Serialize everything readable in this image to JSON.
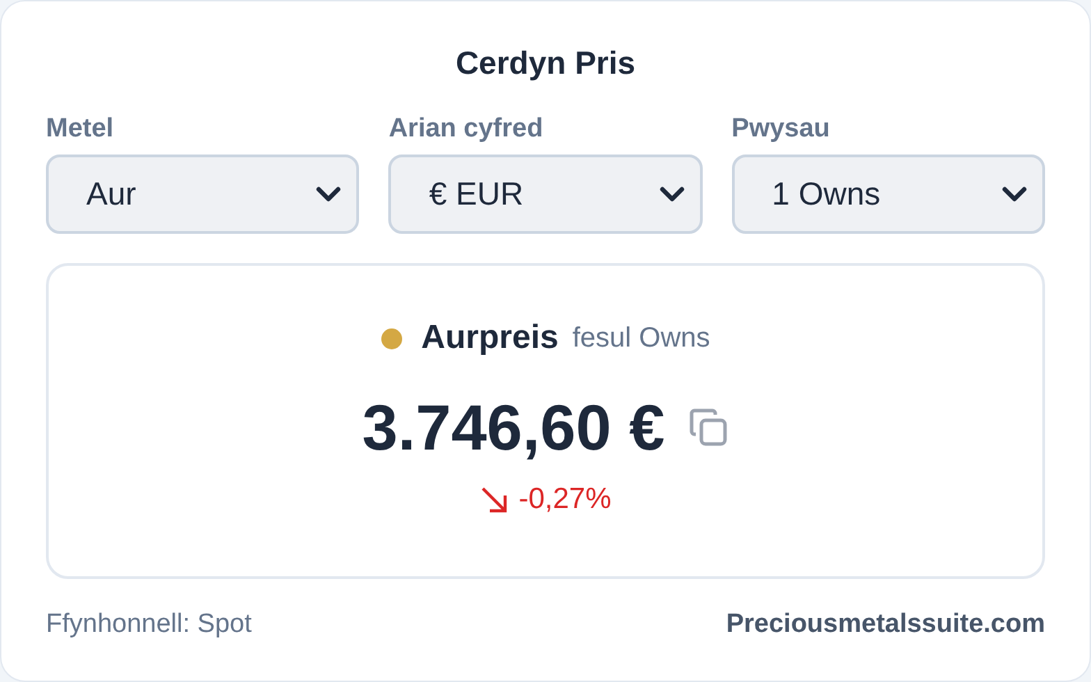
{
  "title": "Cerdyn Pris",
  "selects": [
    {
      "label": "Metel",
      "value": "Aur"
    },
    {
      "label": "Arian cyfred",
      "value": "€ EUR"
    },
    {
      "label": "Pwysau",
      "value": "1 Owns"
    }
  ],
  "price": {
    "name": "Aurpreis",
    "color": "#d4a843",
    "unit": "fesul Owns",
    "value": "3.746,60 €",
    "change": "-0,27%",
    "kind": "down"
  },
  "footer": {
    "source": "Ffynhonnell: Spot",
    "site": "Preciousmetalssuite.com"
  }
}
